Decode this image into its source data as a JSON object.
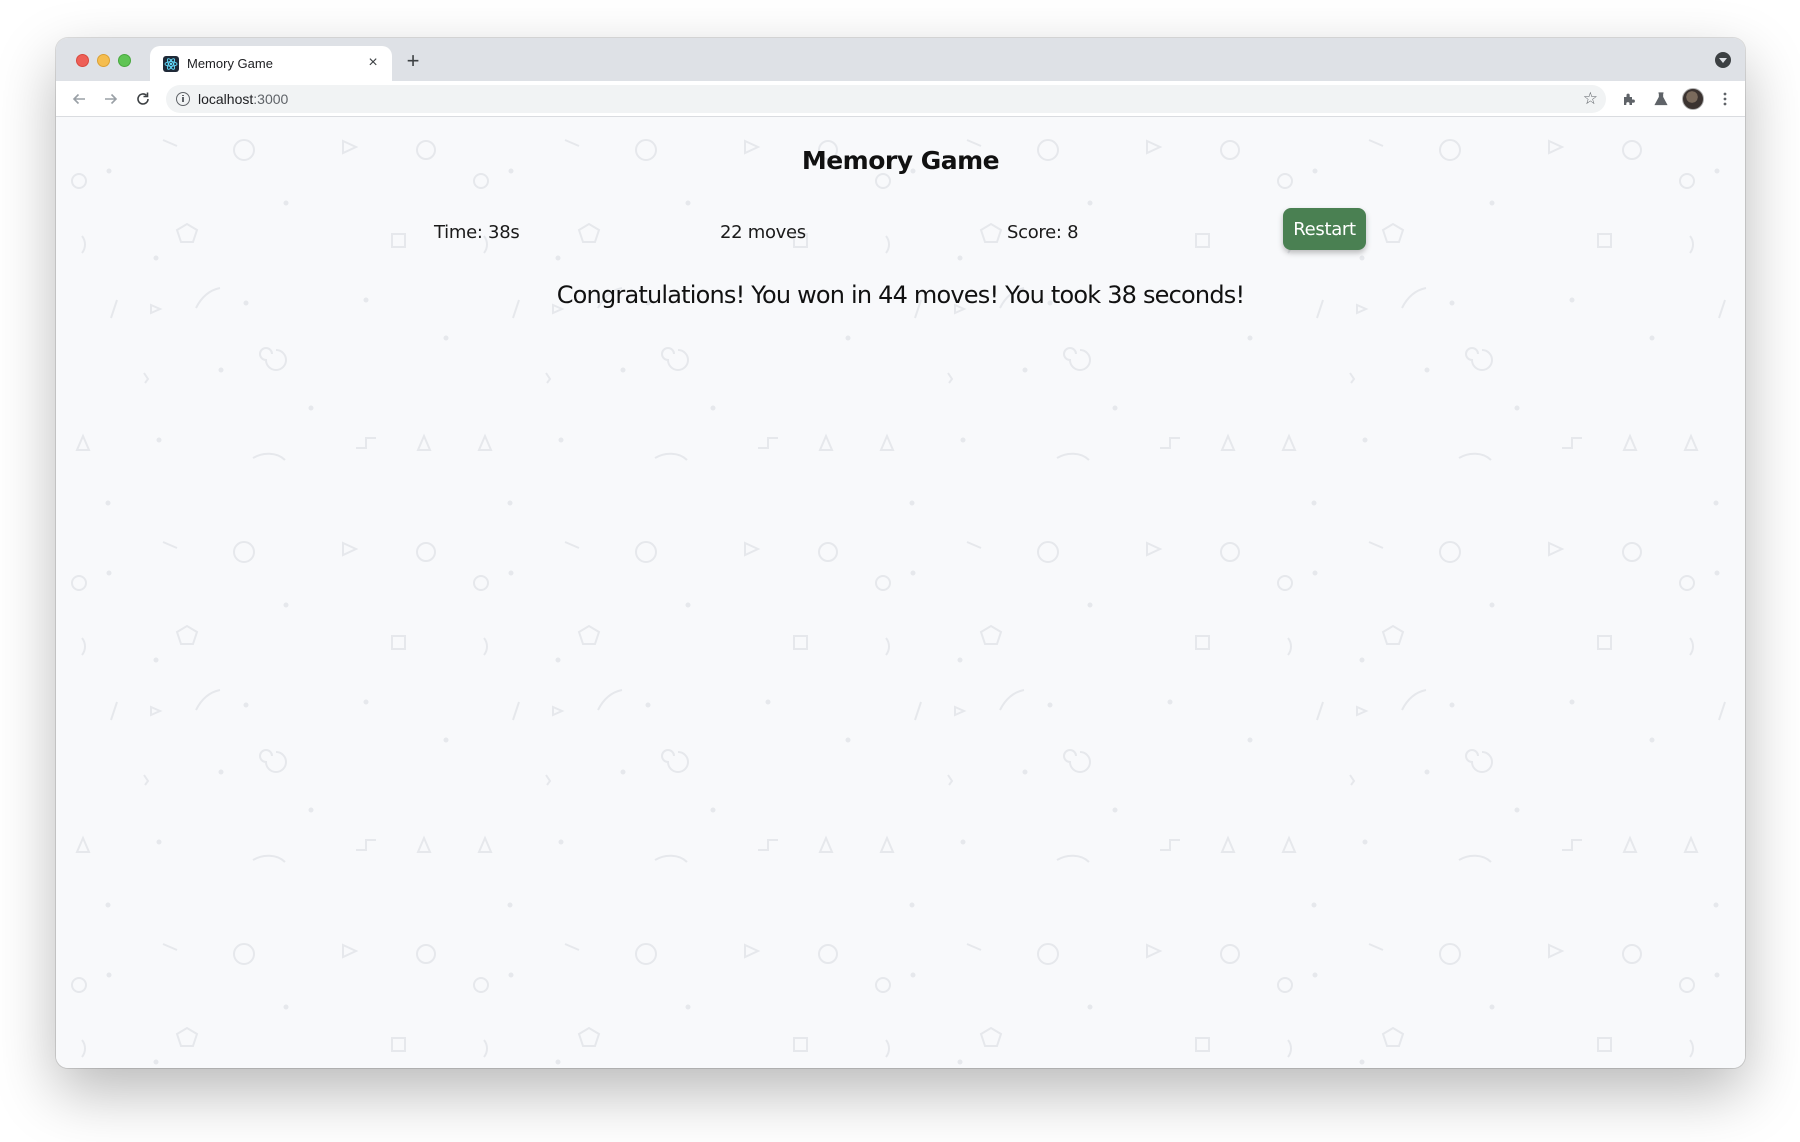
{
  "browser": {
    "tab_title": "Memory Game",
    "tab_close": "×",
    "new_tab": "+",
    "url_host": "localhost",
    "url_port": ":3000",
    "icons": [
      "back-icon",
      "forward-icon",
      "reload-icon",
      "info-icon",
      "star-icon",
      "extensions-icon",
      "labs-icon",
      "profile-avatar",
      "more-menu-icon"
    ]
  },
  "game": {
    "title": "Memory Game",
    "time": "Time: 38s",
    "moves": "22 moves",
    "score": "Score: 8",
    "restart_label": "Restart",
    "win_message": "Congratulations! You won in 44 moves! You took 38 seconds!",
    "accent_color": "#4a8052"
  }
}
